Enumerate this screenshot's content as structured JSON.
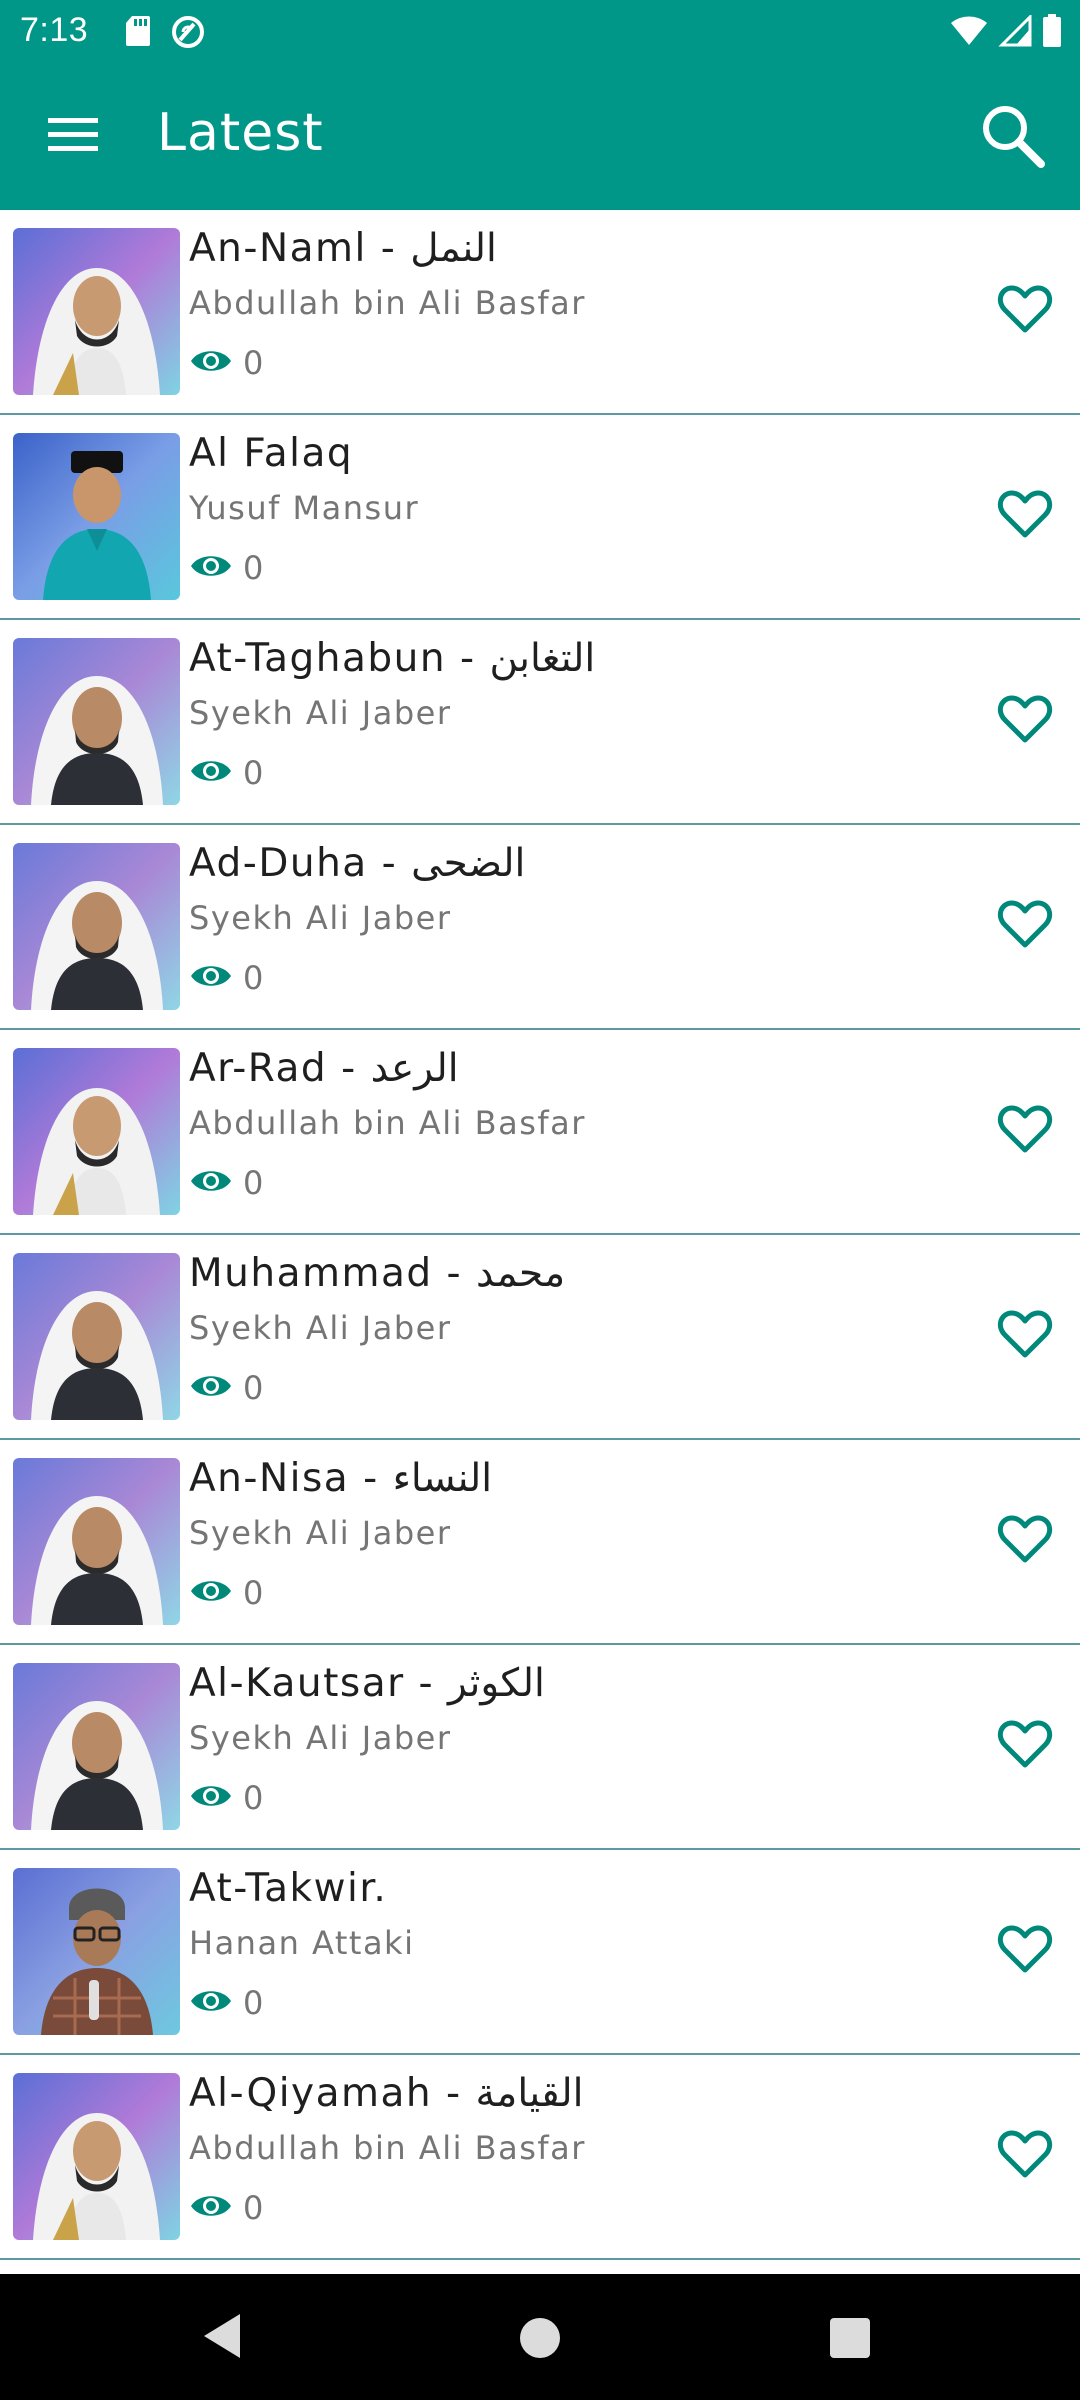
{
  "status_bar": {
    "time": "7:13",
    "icons": [
      "sd-card-icon",
      "sync-icon",
      "wifi-icon",
      "signal-icon",
      "battery-icon"
    ]
  },
  "app_bar": {
    "title": "Latest",
    "menu_icon": "hamburger-menu-icon",
    "search_icon": "search-icon"
  },
  "colors": {
    "primary": "#009688",
    "accent": "#00897B",
    "divider": "#5a9aa0",
    "title_text": "#1f1f1f",
    "secondary_text": "#757575"
  },
  "items": [
    {
      "title": "An-Naml - النمل",
      "artist": "Abdullah bin Ali Basfar",
      "views": "0",
      "avatar": "basfar"
    },
    {
      "title": "Al Falaq",
      "artist": "Yusuf Mansur",
      "views": "0",
      "avatar": "mansur"
    },
    {
      "title": "At-Taghabun - التغابن",
      "artist": "Syekh Ali Jaber",
      "views": "0",
      "avatar": "jaber"
    },
    {
      "title": "Ad-Duha - الضحى",
      "artist": "Syekh Ali Jaber",
      "views": "0",
      "avatar": "jaber"
    },
    {
      "title": "Ar-Rad - الرعد",
      "artist": "Abdullah bin Ali Basfar",
      "views": "0",
      "avatar": "basfar"
    },
    {
      "title": "Muhammad - محمد",
      "artist": "Syekh Ali Jaber",
      "views": "0",
      "avatar": "jaber"
    },
    {
      "title": "An-Nisa - النساء",
      "artist": "Syekh Ali Jaber",
      "views": "0",
      "avatar": "jaber"
    },
    {
      "title": "Al-Kautsar - الكوثر",
      "artist": "Syekh Ali Jaber",
      "views": "0",
      "avatar": "jaber"
    },
    {
      "title": "At-Takwir.",
      "artist": "Hanan Attaki",
      "views": "0",
      "avatar": "attaki"
    },
    {
      "title": "Al-Qiyamah - القيامة",
      "artist": "Abdullah bin Ali Basfar",
      "views": "0",
      "avatar": "basfar"
    }
  ],
  "navigation_bar": {
    "buttons": [
      "back-icon",
      "home-icon",
      "recents-icon"
    ]
  }
}
